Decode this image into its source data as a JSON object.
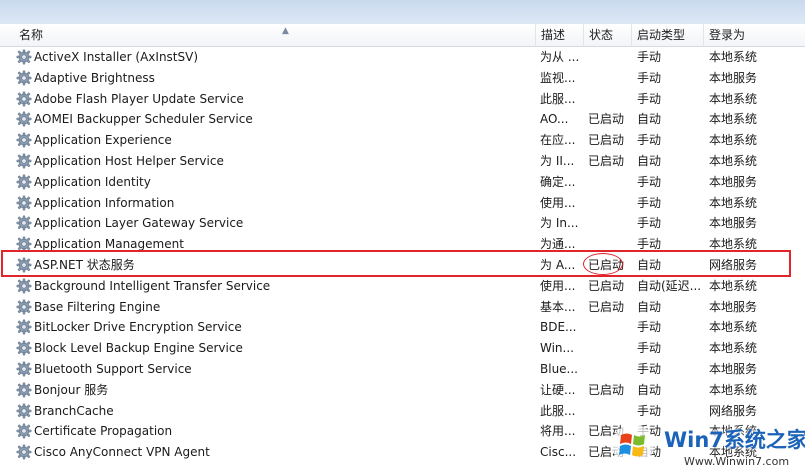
{
  "columns": {
    "name": "名称",
    "description": "描述",
    "status": "状态",
    "startup_type": "启动类型",
    "logon_as": "登录为"
  },
  "services": [
    {
      "name": "ActiveX Installer (AxInstSV)",
      "description": "为从 ...",
      "status": "",
      "startup_type": "手动",
      "logon_as": "本地系统"
    },
    {
      "name": "Adaptive Brightness",
      "description": "监视...",
      "status": "",
      "startup_type": "手动",
      "logon_as": "本地服务"
    },
    {
      "name": "Adobe Flash Player Update Service",
      "description": "此服...",
      "status": "",
      "startup_type": "手动",
      "logon_as": "本地系统"
    },
    {
      "name": "AOMEI Backupper Scheduler Service",
      "description": "AO...",
      "status": "已启动",
      "startup_type": "自动",
      "logon_as": "本地系统"
    },
    {
      "name": "Application Experience",
      "description": "在应...",
      "status": "已启动",
      "startup_type": "手动",
      "logon_as": "本地系统"
    },
    {
      "name": "Application Host Helper Service",
      "description": "为 II...",
      "status": "已启动",
      "startup_type": "自动",
      "logon_as": "本地系统"
    },
    {
      "name": "Application Identity",
      "description": "确定...",
      "status": "",
      "startup_type": "手动",
      "logon_as": "本地服务"
    },
    {
      "name": "Application Information",
      "description": "使用...",
      "status": "",
      "startup_type": "手动",
      "logon_as": "本地系统"
    },
    {
      "name": "Application Layer Gateway Service",
      "description": "为 In...",
      "status": "",
      "startup_type": "手动",
      "logon_as": "本地服务"
    },
    {
      "name": "Application Management",
      "description": "为通...",
      "status": "",
      "startup_type": "手动",
      "logon_as": "本地系统"
    },
    {
      "name": "ASP.NET 状态服务",
      "description": "为 A...",
      "status": "已启动",
      "startup_type": "自动",
      "logon_as": "网络服务"
    },
    {
      "name": "Background Intelligent Transfer Service",
      "description": "使用...",
      "status": "已启动",
      "startup_type": "自动(延迟...",
      "logon_as": "本地系统"
    },
    {
      "name": "Base Filtering Engine",
      "description": "基本...",
      "status": "已启动",
      "startup_type": "自动",
      "logon_as": "本地服务"
    },
    {
      "name": "BitLocker Drive Encryption Service",
      "description": "BDE...",
      "status": "",
      "startup_type": "手动",
      "logon_as": "本地系统"
    },
    {
      "name": "Block Level Backup Engine Service",
      "description": "Win...",
      "status": "",
      "startup_type": "手动",
      "logon_as": "本地系统"
    },
    {
      "name": "Bluetooth Support Service",
      "description": "Blue...",
      "status": "",
      "startup_type": "手动",
      "logon_as": "本地服务"
    },
    {
      "name": "Bonjour 服务",
      "description": "让硬...",
      "status": "已启动",
      "startup_type": "自动",
      "logon_as": "本地系统"
    },
    {
      "name": "BranchCache",
      "description": "此服...",
      "status": "",
      "startup_type": "手动",
      "logon_as": "网络服务"
    },
    {
      "name": "Certificate Propagation",
      "description": "将用...",
      "status": "已启动",
      "startup_type": "手动",
      "logon_as": "本地系统"
    },
    {
      "name": "Cisco AnyConnect VPN Agent",
      "description": "Cisc...",
      "status": "已启动",
      "startup_type": "自动",
      "logon_as": "本地系统"
    }
  ],
  "watermark": {
    "title": "Win7系统之家",
    "url": "Www.Winwin7.com"
  },
  "colors": {
    "highlight": "#e0252b",
    "header_strip": "#c9d9ee"
  },
  "icons": {
    "service": "gear-icon",
    "sort": "sort-ascending-icon"
  }
}
